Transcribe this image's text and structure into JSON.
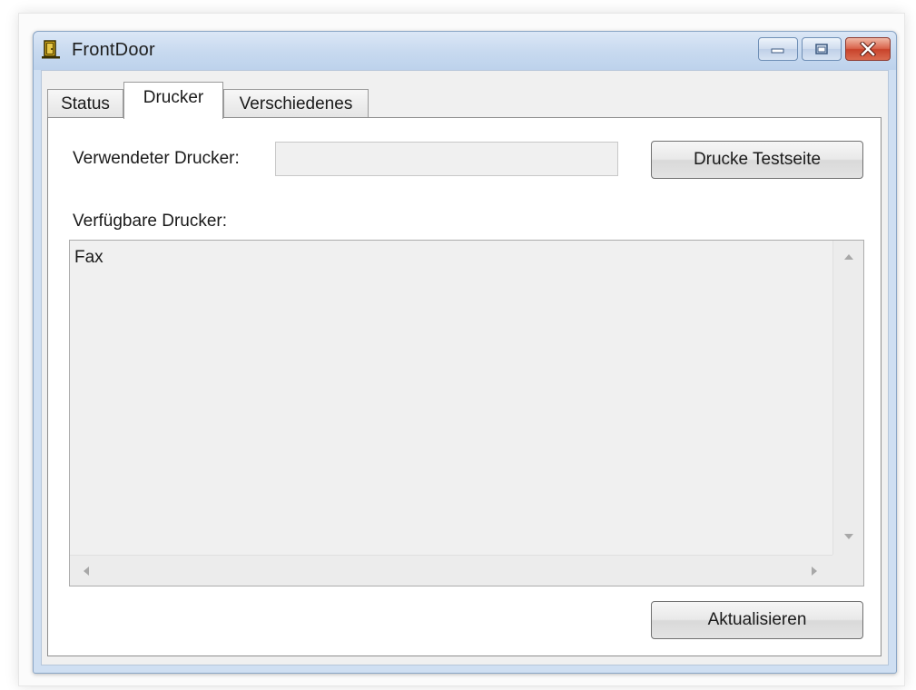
{
  "window": {
    "title": "FrontDoor",
    "icon": "door-icon"
  },
  "caption_buttons": {
    "minimize": "minimize-icon",
    "maximize": "maximize-icon",
    "close": "close-icon"
  },
  "tabs": [
    {
      "label": "Status",
      "selected": false
    },
    {
      "label": "Drucker",
      "selected": true
    },
    {
      "label": "Verschiedenes",
      "selected": false
    }
  ],
  "drucker": {
    "used_printer_label": "Verwendeter Drucker:",
    "used_printer_value": "",
    "print_test_button": "Drucke Testseite",
    "available_printers_label": "Verfügbare Drucker:",
    "available_printers": [
      "Fax"
    ],
    "refresh_button": "Aktualisieren"
  },
  "colors": {
    "titlebar": "#c7d9ef",
    "close_button": "#c8432b",
    "client_bg": "#f0f0f0"
  }
}
